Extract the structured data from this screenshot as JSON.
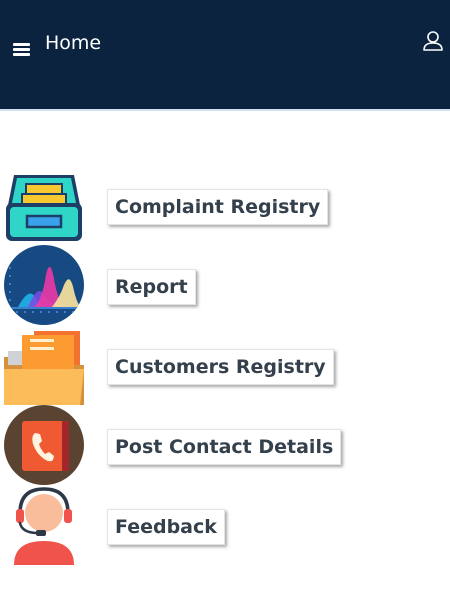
{
  "header": {
    "title": "Home",
    "menu_icon": "hamburger-menu-icon",
    "user_icon": "user-icon",
    "background": "#0c2340"
  },
  "menu": {
    "items": [
      {
        "label": "Complaint Registry",
        "icon": "file-drawer-icon"
      },
      {
        "label": "Report",
        "icon": "chart-icon"
      },
      {
        "label": "Customers Registry",
        "icon": "folder-icon"
      },
      {
        "label": "Post Contact Details",
        "icon": "phone-book-icon"
      },
      {
        "label": "Feedback",
        "icon": "support-agent-icon"
      }
    ]
  }
}
